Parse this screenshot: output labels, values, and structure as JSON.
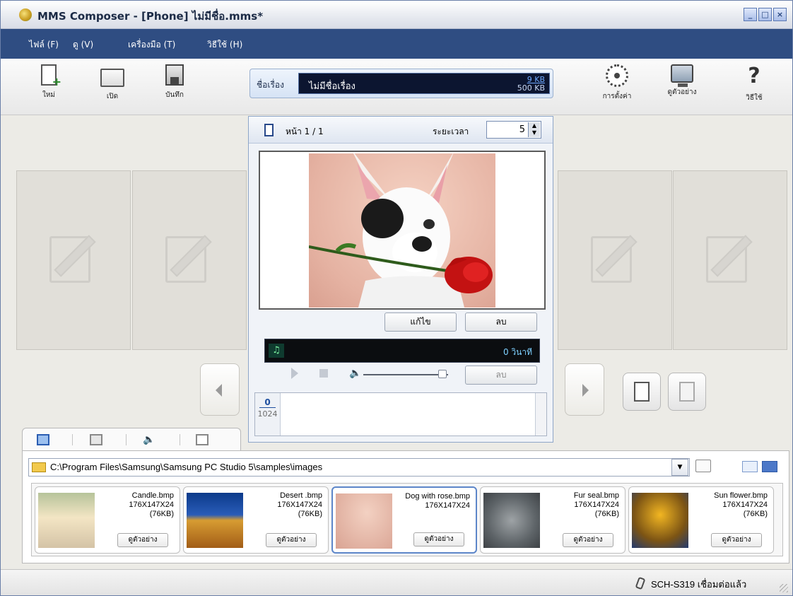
{
  "window": {
    "title": "MMS Composer - [Phone] ไม่มีชื่อ.mms*",
    "controls": {
      "minimize": "_",
      "maximize": "□",
      "close": "×"
    }
  },
  "menu": [
    {
      "label": "ไฟล์ (F)"
    },
    {
      "label": "ดู (V)"
    },
    {
      "label": "เครื่องมือ (T)"
    },
    {
      "label": "วิธีใช้ (H)"
    }
  ],
  "toolbar": {
    "new_label": "ใหม่",
    "open_label": "เปิด",
    "save_label": "บันทึก",
    "settings_label": "การตั้งค่า",
    "preview_label": "ดูตัวอย่าง",
    "help_label": "วิธีใช้",
    "icons": [
      "new-file-icon",
      "open-folder-icon",
      "save-disk-icon",
      "gear-icon",
      "monitor-icon",
      "help-icon"
    ]
  },
  "subject": {
    "label": "ชื่อเรื่อง",
    "value": "ไม่มีชื่อเรื่อง",
    "size_current": "9 KB",
    "size_max": "500 KB"
  },
  "editor": {
    "page_label": "หน้า 1 / 1",
    "duration_label": "ระยะเวลา",
    "duration_value": "5",
    "edit_button": "แก้ไข",
    "delete_image_button": "ลบ",
    "audio_seconds": "0 วินาที",
    "delete_audio_button": "ลบ",
    "text_count_current": "0",
    "text_count_max": "1024"
  },
  "library": {
    "path": "C:\\Program Files\\Samsung\\Samsung PC Studio 5\\samples\\images",
    "preview_button": "ดูตัวอย่าง",
    "items": [
      {
        "name": "Candle.bmp",
        "dims": "176X147X24",
        "size": "(76KB)",
        "selected": false
      },
      {
        "name": "Desert .bmp",
        "dims": "176X147X24",
        "size": "(76KB)",
        "selected": false
      },
      {
        "name": "Dog with rose.bmp",
        "dims": "176X147X24",
        "size": "",
        "selected": true
      },
      {
        "name": "Fur seal.bmp",
        "dims": "176X147X24",
        "size": "(76KB)",
        "selected": false
      },
      {
        "name": "Sun flower.bmp",
        "dims": "176X147X24",
        "size": "(76KB)",
        "selected": false
      }
    ]
  },
  "status": {
    "text": "SCH-S319 เชื่อมต่อแล้ว"
  }
}
